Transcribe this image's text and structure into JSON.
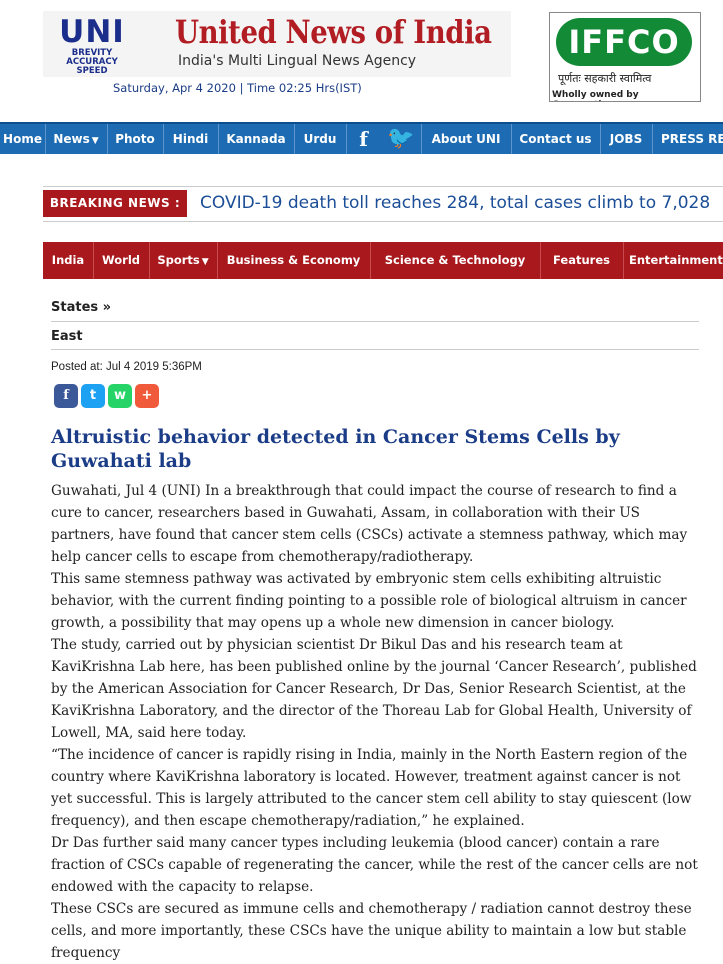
{
  "header": {
    "uni_mark": "UNI",
    "uni_tags": [
      "BREVITY",
      "ACCURACY",
      "SPEED"
    ],
    "brand_name": "United News of India",
    "brand_subtitle": "India's Multi Lingual News Agency",
    "dateline": "Saturday, Apr 4 2020 | Time 02:25 Hrs(IST)",
    "ad": {
      "logo_text": "IFFCO",
      "hindi_text": "पूर्णतः सहकारी स्वामित्व",
      "footer_text": "Wholly owned by Cooperatives"
    }
  },
  "nav": {
    "items": [
      "Home",
      "News",
      "Photo",
      "Hindi",
      "Kannada",
      "Urdu",
      "About UNI",
      "Contact us",
      "JOBS",
      "PRESS RE"
    ],
    "facebook_icon": "f",
    "twitter_icon": "🐦"
  },
  "breaking": {
    "label": "BREAKING NEWS :",
    "text": "COVID-19 death toll reaches 284, total cases climb to 7,028"
  },
  "categories": [
    "India",
    "World",
    "Sports",
    "Business & Economy",
    "Science & Technology",
    "Features",
    "Entertainment"
  ],
  "breadcrumb": {
    "states": "States »",
    "region": "East"
  },
  "posted": "Posted at: Jul 4 2019 5:36PM",
  "share": {
    "facebook": "f",
    "twitter": "t",
    "whatsapp": "w",
    "more": "+"
  },
  "article": {
    "headline": "Altruistic behavior detected in Cancer Stems Cells by Guwahati lab",
    "paragraphs": [
      "Guwahati, Jul 4 (UNI) In a breakthrough that could impact the course of research to find a cure to cancer, researchers based in Guwahati, Assam, in collaboration with their US partners, have found that cancer stem cells (CSCs) activate a stemness pathway, which may help cancer cells to escape from chemotherapy/radiotherapy.",
      "This same stemness pathway was activated by embryonic stem cells exhibiting altruistic behavior, with the current finding pointing to a possible role of biological altruism in cancer growth, a possibility that may opens up a whole new dimension in cancer biology.",
      "The study, carried out by physician scientist Dr Bikul Das and his research team at KaviKrishna Lab here, has been published online by the journal ‘Cancer Research’, published by the American Association for Cancer Research, Dr Das, Senior Research Scientist, at the KaviKrishna Laboratory, and the director of the Thoreau Lab for Global Health, University of Lowell, MA, said here today.",
      "“The incidence of cancer is rapidly rising in India, mainly in the North Eastern region of the country where KaviKrishna laboratory is located. However, treatment against cancer is not yet successful. This is largely attributed to the cancer stem cell ability to stay quiescent (low frequency), and then escape chemotherapy/radiation,” he explained.",
      "Dr Das further said many cancer types including leukemia (blood cancer) contain a rare fraction of CSCs capable of regenerating the cancer, while the rest of the cancer cells are not endowed with the capacity to relapse.",
      "These CSCs are secured as immune cells and chemotherapy / radiation cannot destroy these cells, and more importantly, these CSCs have the unique ability to maintain a low but stable frequency"
    ]
  },
  "colors": {
    "nav_blue": "#1d6cb3",
    "brand_red": "#a8181d",
    "headline_blue": "#1b3c86"
  }
}
